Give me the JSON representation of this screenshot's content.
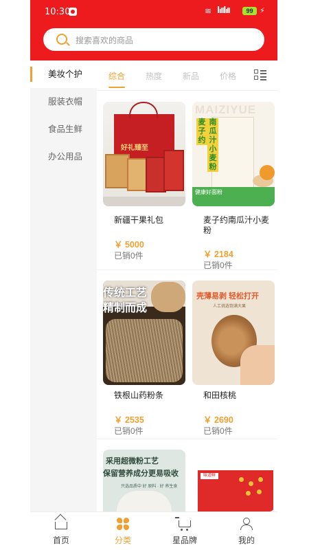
{
  "status_bar": {
    "time": "10:30",
    "signal": "ꟾıllꟾıll",
    "battery": "99",
    "wifi_icon": "wifi-icon",
    "bolt_icon": "charging-icon"
  },
  "search": {
    "placeholder": "搜索喜欢的商品",
    "icon": "search-icon"
  },
  "sidebar": {
    "items": [
      {
        "label": "美妆个护",
        "active": true
      },
      {
        "label": "服装衣帽",
        "active": false
      },
      {
        "label": "食品生鲜",
        "active": false
      },
      {
        "label": "办公用品",
        "active": false
      }
    ]
  },
  "tabs": {
    "items": [
      {
        "label": "综合",
        "active": true
      },
      {
        "label": "热度",
        "active": false
      },
      {
        "label": "新品",
        "active": false
      },
      {
        "label": "价格",
        "active": false
      }
    ],
    "layout_icon": "list-layout-icon"
  },
  "products": [
    {
      "name": "新疆干果礼包",
      "price": "￥ 5000",
      "sold": "已销0件",
      "image_text": "好礼臻至"
    },
    {
      "name": "麦子约南瓜汁小麦粉",
      "price": "￥ 2184",
      "sold": "已销0件",
      "image_text": {
        "watermark": "MAIZIYUE",
        "v1": "麦子约",
        "v2": "南瓜汁小麦粉",
        "footer": "健康好面粉"
      }
    },
    {
      "name": "铁根山药粉条",
      "price": "￥ 2535",
      "sold": "已销0件",
      "image_text": {
        "line1": "传统工艺",
        "line2": "精制而成"
      }
    },
    {
      "name": "和田核桃",
      "price": "￥ 2690",
      "sold": "已销0件",
      "image_text": {
        "headline": "壳薄易剥 轻松打开",
        "sub": "人工挑选饱满大果"
      }
    },
    {
      "name": "",
      "price": "",
      "sold": "",
      "image_text": {
        "line1": "采用超微粉工艺",
        "line2": "保留营养成分更易吸收",
        "sub": "只选品质中 好 原料 · 好 养生食"
      }
    },
    {
      "name": "",
      "price": "",
      "sold": "",
      "image_text": {
        "label": "味道鲜"
      }
    }
  ],
  "bottom_nav": {
    "items": [
      {
        "label": "首页",
        "icon": "home-icon",
        "active": false
      },
      {
        "label": "分类",
        "icon": "category-icon",
        "active": true
      },
      {
        "label": "星品牌",
        "icon": "cart-icon",
        "active": false
      },
      {
        "label": "我的",
        "icon": "user-icon",
        "active": false
      }
    ]
  },
  "colors": {
    "header_red": "#ee1b1e",
    "accent_orange": "#f0a030",
    "sidebar_bg": "#f5f5f5"
  }
}
